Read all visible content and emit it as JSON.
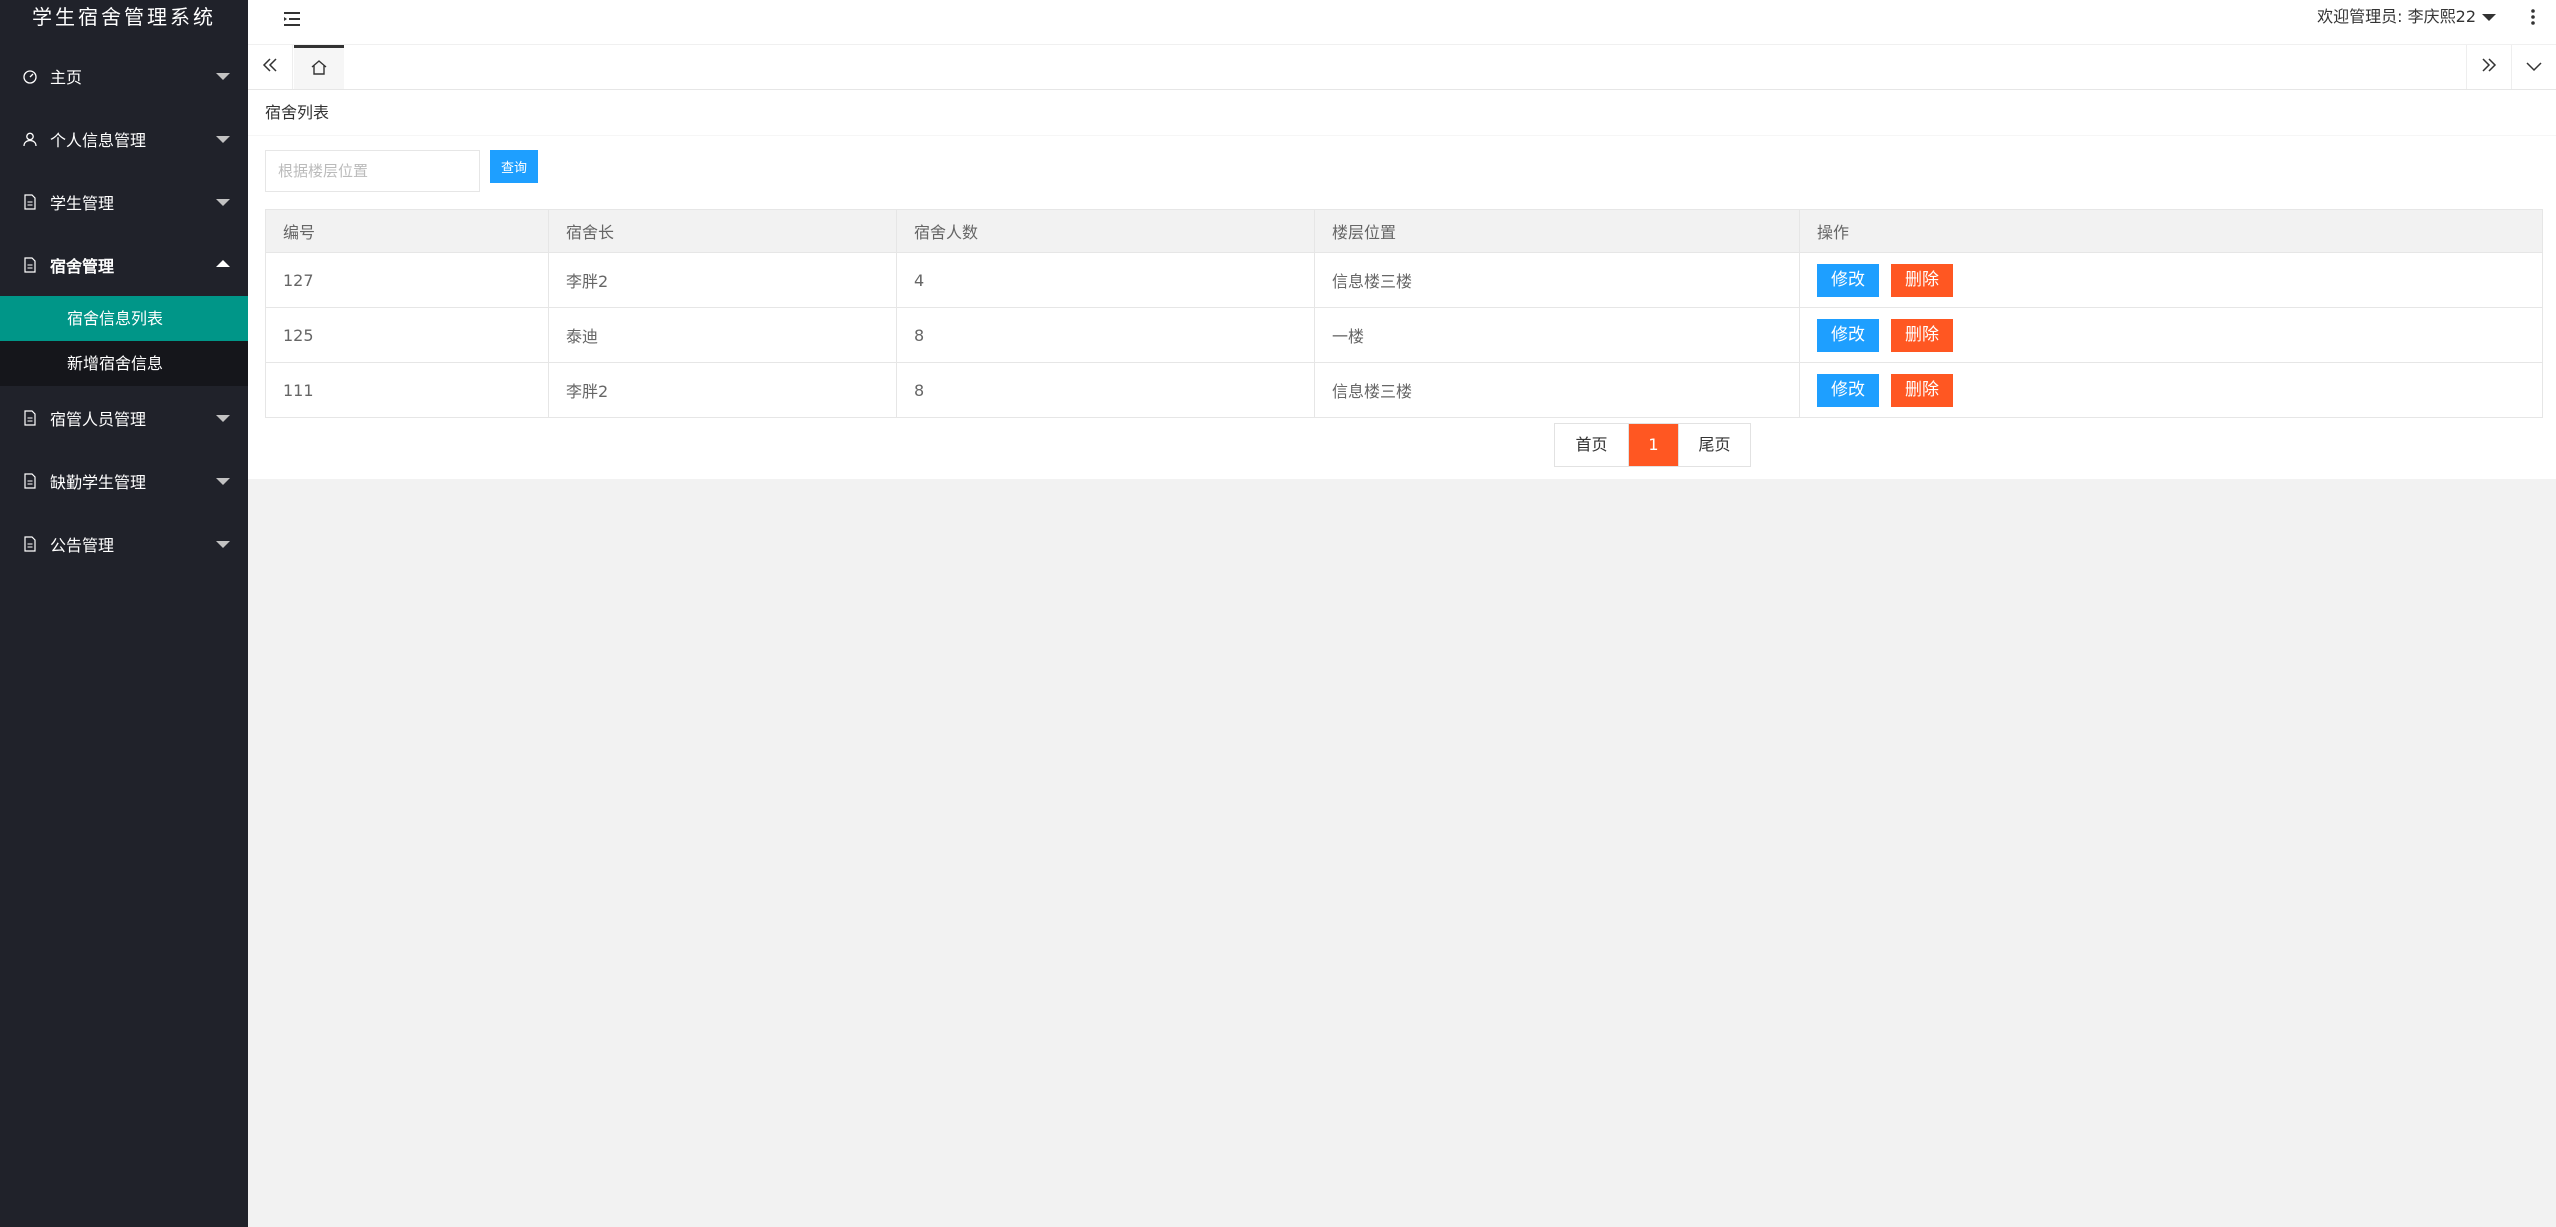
{
  "app": {
    "title": "学生宿舍管理系统"
  },
  "sidebar": {
    "items": [
      {
        "label": "主页",
        "icon": "dashboard-icon"
      },
      {
        "label": "个人信息管理",
        "icon": "user-icon"
      },
      {
        "label": "学生管理",
        "icon": "document-icon"
      },
      {
        "label": "宿舍管理",
        "icon": "document-icon",
        "open": true,
        "children": [
          {
            "label": "宿舍信息列表",
            "active": true
          },
          {
            "label": "新增宿舍信息"
          }
        ]
      },
      {
        "label": "宿管人员管理",
        "icon": "document-icon"
      },
      {
        "label": "缺勤学生管理",
        "icon": "document-icon"
      },
      {
        "label": "公告管理",
        "icon": "document-icon"
      }
    ]
  },
  "header": {
    "welcome": "欢迎管理员: 李庆熙22"
  },
  "content": {
    "title": "宿舍列表",
    "search": {
      "placeholder": "根据楼层位置",
      "button": "查询"
    },
    "table": {
      "headers": [
        "编号",
        "宿舍长",
        "宿舍人数",
        "楼层位置",
        "操作"
      ],
      "rows": [
        {
          "id": "127",
          "leader": "李胖2",
          "count": "4",
          "floor": "信息楼三楼"
        },
        {
          "id": "125",
          "leader": "泰迪",
          "count": "8",
          "floor": "一楼"
        },
        {
          "id": "111",
          "leader": "李胖2",
          "count": "8",
          "floor": "信息楼三楼"
        }
      ],
      "edit_label": "修改",
      "delete_label": "删除"
    },
    "pager": {
      "first": "首页",
      "current": "1",
      "last": "尾页"
    }
  },
  "colors": {
    "sidebar_bg": "#20222a",
    "active_green": "#009688",
    "primary_blue": "#1e9fff",
    "danger_orange": "#ff5722"
  }
}
